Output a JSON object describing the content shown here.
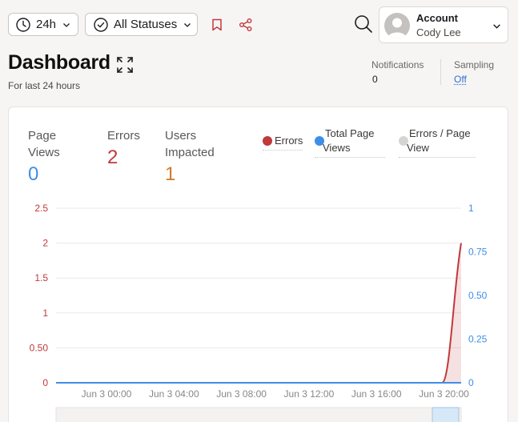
{
  "toolbar": {
    "time_range": "24h",
    "status_filter": "All Statuses",
    "bookmark_icon": "bookmark-icon",
    "share_icon": "share-icon",
    "search_icon": "search-icon"
  },
  "account": {
    "title": "Account",
    "name": "Cody Lee"
  },
  "header": {
    "title": "Dashboard",
    "subtitle": "For last 24 hours"
  },
  "meta": {
    "notifications_label": "Notifications",
    "notifications_value": "0",
    "sampling_label": "Sampling",
    "sampling_value": "Off"
  },
  "stats": {
    "page_views_label_1": "Page",
    "page_views_label_2": "Views",
    "page_views_value": "0",
    "errors_label": "Errors",
    "errors_value": "2",
    "users_label_1": "Users",
    "users_label_2": "Impacted",
    "users_value": "1"
  },
  "legend": {
    "errors": "Errors",
    "total_page_views_1": "Total Page",
    "total_page_views_2": "Views",
    "errors_per_page_1": "Errors / Page",
    "errors_per_page_2": "View"
  },
  "colors": {
    "errors": "#c0393b",
    "page_views": "#3f8ee6",
    "users": "#d27a2b",
    "errors_per_page": "#d7d5d3",
    "accent_red": "#c0393b"
  },
  "chart_data": {
    "type": "line",
    "x": [
      "Jun 3 00:00",
      "Jun 3 04:00",
      "Jun 3 08:00",
      "Jun 3 12:00",
      "Jun 3 16:00",
      "Jun 3 20:00"
    ],
    "series": [
      {
        "name": "Errors",
        "axis": "left",
        "values": [
          0,
          0,
          0,
          0,
          0,
          2
        ]
      },
      {
        "name": "Total Page Views",
        "axis": "right",
        "values": [
          0,
          0,
          0,
          0,
          0,
          0
        ]
      }
    ],
    "y_left_ticks": [
      "0",
      "0.50",
      "1",
      "1.5",
      "2",
      "2.5"
    ],
    "y_right_ticks": [
      "0",
      "0.25",
      "0.50",
      "0.75",
      "1"
    ],
    "ylim_left": [
      0,
      2.5
    ],
    "ylim_right": [
      0,
      1
    ],
    "grid": true
  }
}
